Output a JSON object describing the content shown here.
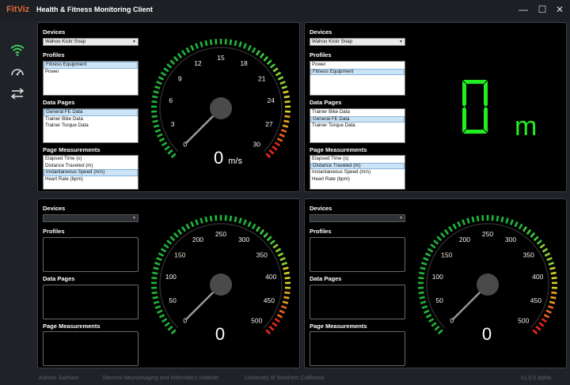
{
  "app": {
    "logo": "FitViz",
    "title": "Health & Fitness Monitoring Client",
    "window_controls": {
      "minimize": "—",
      "maximize": "☐",
      "close": "✕"
    }
  },
  "sidebar": {
    "items": [
      {
        "icon": "wifi-icon"
      },
      {
        "icon": "speedometer-icon"
      },
      {
        "icon": "swap-arrows-icon"
      }
    ]
  },
  "colors": {
    "accent": "#e06a3c",
    "active_icon": "#3fe060",
    "segment_green": "#22ee22"
  },
  "labels": {
    "devices": "Devices",
    "profiles": "Profiles",
    "data_pages": "Data Pages",
    "page_measurements": "Page Measurements"
  },
  "panels": [
    {
      "device": "Wahoo Kickr Snap",
      "profiles": [
        "Fitness Equipment",
        "Power"
      ],
      "profiles_selected": 0,
      "data_pages": [
        "General FE Data",
        "Trainer Bike Data",
        "Trainer Torque Data"
      ],
      "data_pages_selected": 0,
      "measurements": [
        "Elapsed Time (s)",
        "Distance Traveled (m)",
        "Instantaneous Speed (m/s)",
        "Heart Rate (bpm)"
      ],
      "measurements_selected": 2,
      "display": "gauge",
      "gauge": {
        "min": 0,
        "max": 30,
        "ticks": [
          "0",
          "3",
          "6",
          "9",
          "12",
          "15",
          "18",
          "21",
          "24",
          "27",
          "30"
        ],
        "value": 0,
        "readout": "0",
        "unit": "m/s"
      }
    },
    {
      "device": "Wahoo Kickr Snap",
      "profiles": [
        "Power",
        "Fitness Equipment"
      ],
      "profiles_selected": 1,
      "data_pages": [
        "Trainer Bike Data",
        "General FE Data",
        "Trainer Torque Data"
      ],
      "data_pages_selected": 1,
      "measurements": [
        "Elapsed Time (s)",
        "Distance Traveled (m)",
        "Instantaneous Speed (m/s)",
        "Heart Rate (bpm)"
      ],
      "measurements_selected": 1,
      "display": "digital",
      "digital": {
        "value": "0",
        "unit": "m"
      }
    },
    {
      "device": "",
      "profiles": [],
      "profiles_selected": -1,
      "data_pages": [],
      "data_pages_selected": -1,
      "measurements": [],
      "measurements_selected": -1,
      "display": "gauge",
      "gauge": {
        "min": 0,
        "max": 500,
        "ticks": [
          "0",
          "50",
          "100",
          "150",
          "200",
          "250",
          "300",
          "350",
          "400",
          "450",
          "500"
        ],
        "value": 0,
        "readout": "0",
        "unit": ""
      }
    },
    {
      "device": "",
      "profiles": [],
      "profiles_selected": -1,
      "data_pages": [],
      "data_pages_selected": -1,
      "measurements": [],
      "measurements_selected": -1,
      "display": "gauge",
      "gauge": {
        "min": 0,
        "max": 500,
        "ticks": [
          "0",
          "50",
          "100",
          "150",
          "200",
          "250",
          "300",
          "350",
          "400",
          "450",
          "500"
        ],
        "value": 0,
        "readout": "0",
        "unit": ""
      }
    }
  ],
  "footer": {
    "author": "Ashwin Sakhare",
    "institute": "Stevens Neuroimaging and Informatics Institute",
    "university": "University of Southern California",
    "version": "v1.0.0 alpha"
  }
}
